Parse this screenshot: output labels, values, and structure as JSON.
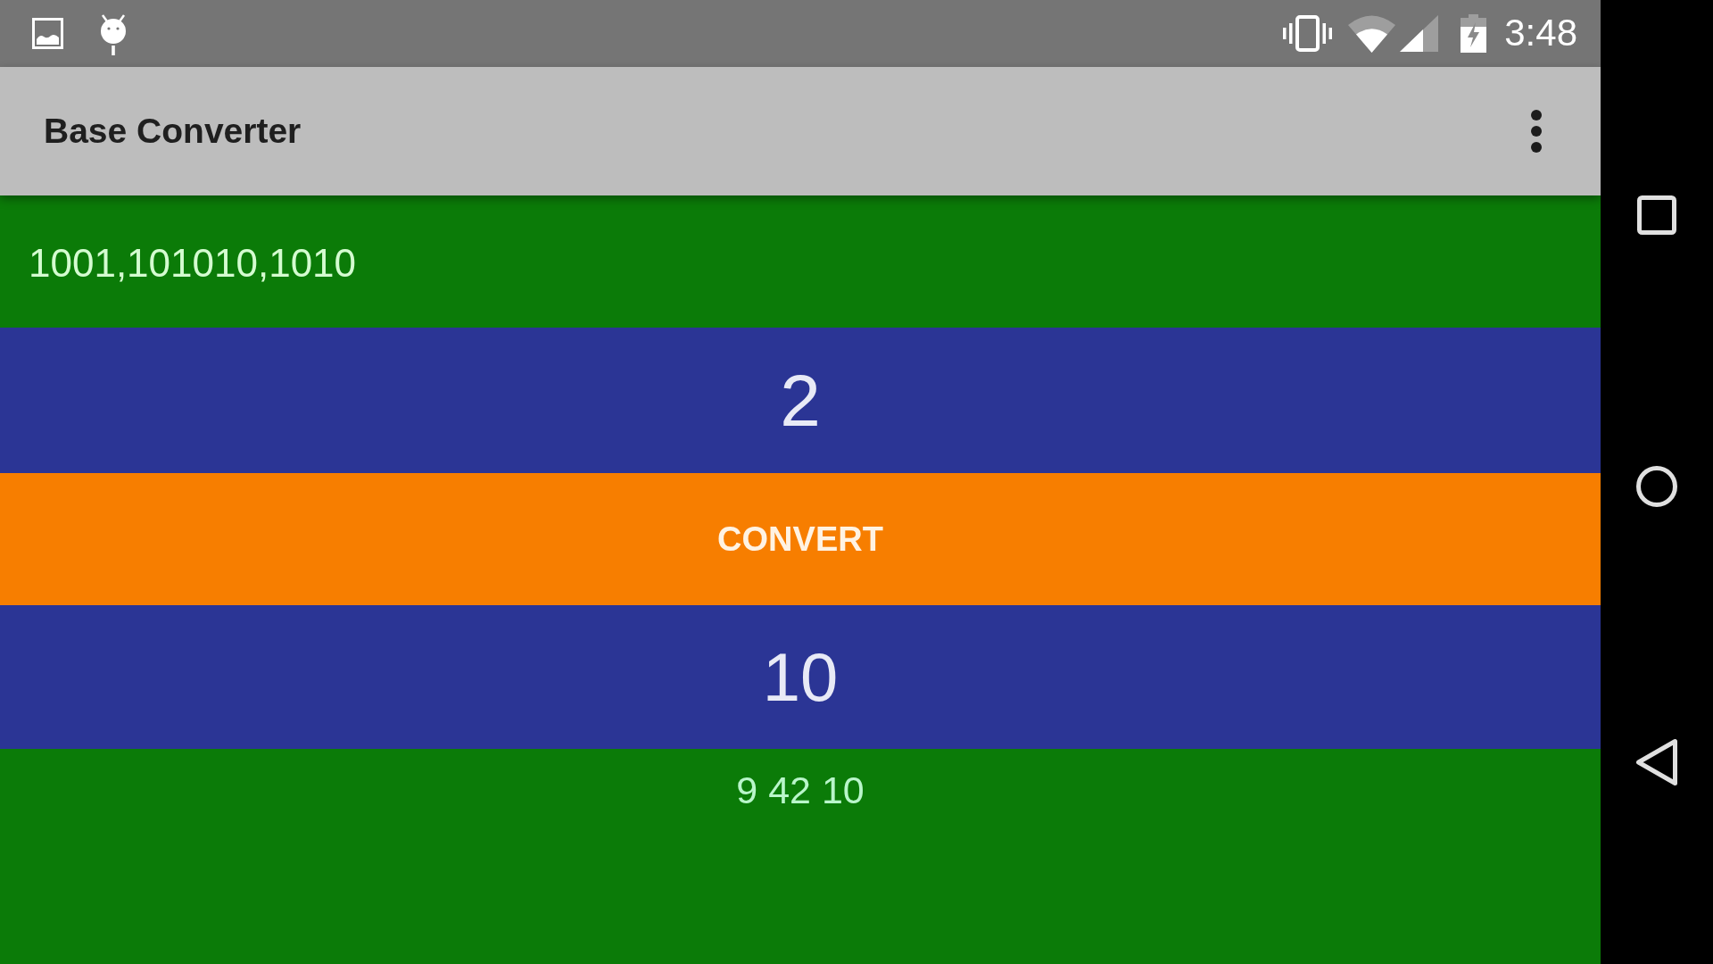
{
  "status_bar": {
    "time": "3:48"
  },
  "app_bar": {
    "title": "Base Converter"
  },
  "input_field": {
    "value": "1001,101010,1010"
  },
  "upper_number_field": {
    "value": "2"
  },
  "convert_button": {
    "label": "CONVERT"
  },
  "lower_number_field": {
    "value": "10"
  },
  "result": {
    "text": "9 42 10"
  }
}
